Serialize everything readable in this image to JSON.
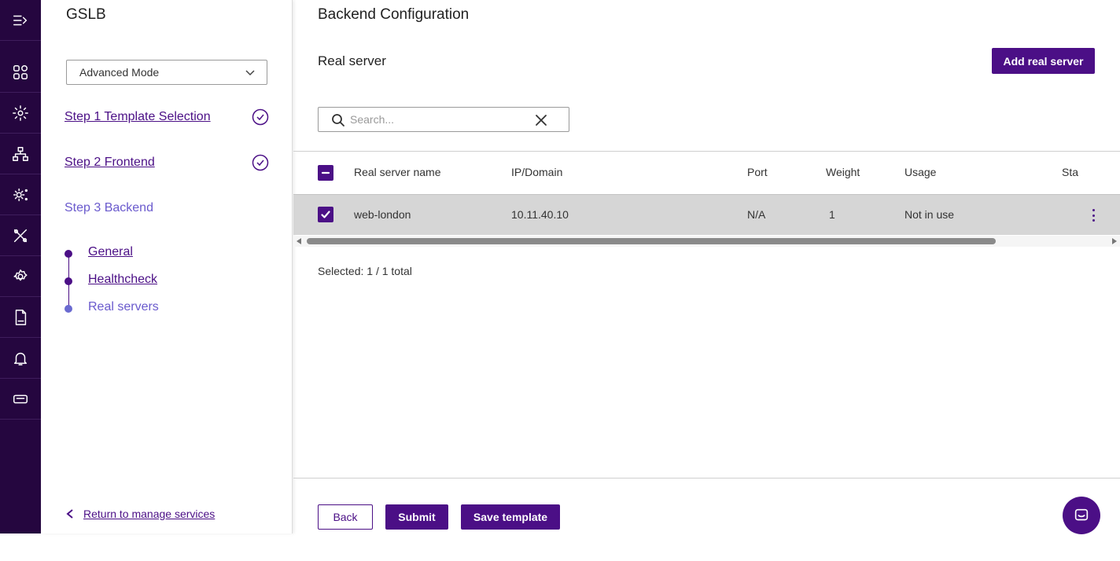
{
  "rail": {
    "items": [
      {
        "icon": "expand-menu-icon"
      },
      {
        "icon": "dashboard-icon"
      },
      {
        "icon": "services-gear-icon"
      },
      {
        "icon": "network-topology-icon"
      },
      {
        "icon": "settings-cluster-icon"
      },
      {
        "icon": "tools-icon"
      },
      {
        "icon": "settings-icon"
      },
      {
        "icon": "log-file-icon"
      },
      {
        "icon": "bell-icon"
      },
      {
        "icon": "ticket-icon"
      },
      {
        "icon": "info-icon"
      }
    ]
  },
  "steps_panel": {
    "title": "GSLB",
    "mode_select": {
      "value": "Advanced Mode"
    },
    "step1": {
      "label": "Step 1 Template Selection",
      "completed": true
    },
    "step2": {
      "label": "Step 2 Frontend",
      "completed": true
    },
    "step3": {
      "label": "Step 3 Backend",
      "current": true
    },
    "substeps": [
      {
        "label": "General",
        "current": false
      },
      {
        "label": "Healthcheck",
        "current": false
      },
      {
        "label": "Real servers",
        "current": true
      }
    ],
    "return_link": "Return to manage services"
  },
  "main": {
    "page_title": "Backend Configuration",
    "section_title": "Real server",
    "add_button": "Add real server",
    "search": {
      "placeholder": "Search...",
      "value": ""
    },
    "table": {
      "columns": [
        "Real server name",
        "IP/Domain",
        "Port",
        "Weight",
        "Usage",
        "Sta"
      ],
      "header_checkbox": "indeterminate",
      "rows": [
        {
          "selected": true,
          "name": "web-london",
          "ip": "10.11.40.10",
          "port": "N/A",
          "weight": "1",
          "usage": "Not in use"
        }
      ]
    },
    "selected_info": "Selected: 1 / 1 total",
    "footer": {
      "back": "Back",
      "submit": "Submit",
      "save_template": "Save template"
    }
  },
  "colors": {
    "rail_bg": "#25063f",
    "accent": "#4b0f86",
    "current_step": "#6a5acd",
    "selected_row_bg": "#d6d6d6"
  }
}
